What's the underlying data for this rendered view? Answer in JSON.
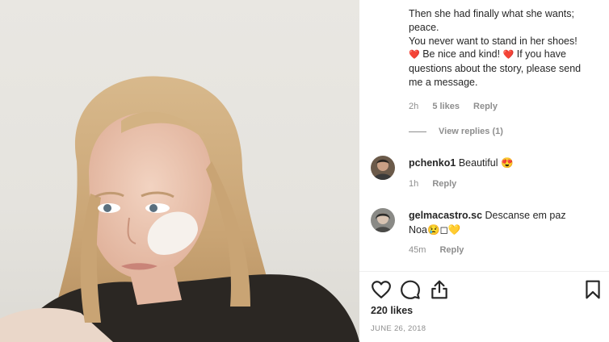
{
  "caption": {
    "lines": [
      "Then she had finally what she wants;",
      "peace.",
      "You never want to stand in her shoes!",
      "Be nice and kind!",
      "If you have",
      "questions about the story, please send",
      "me a message."
    ],
    "time": "2h",
    "likes": "5 likes",
    "reply": "Reply",
    "view_replies": "View replies (1)"
  },
  "comments": [
    {
      "username": "pchenko1",
      "text": "Beautiful",
      "emoji": "😍",
      "time": "1h",
      "reply": "Reply"
    },
    {
      "username": "gelmacastro.sc",
      "text": "Descanse em paz",
      "text2": "Noa",
      "emoji": "😢◻💛",
      "time": "45m",
      "reply": "Reply"
    }
  ],
  "post": {
    "likes": "220 likes",
    "date": "JUNE 26, 2018"
  },
  "icons": [
    "heart-icon",
    "comment-icon",
    "share-icon",
    "bookmark-icon"
  ],
  "colors": {
    "heart": "#ed4956",
    "text": "#262626",
    "muted": "#8e8e8e"
  }
}
